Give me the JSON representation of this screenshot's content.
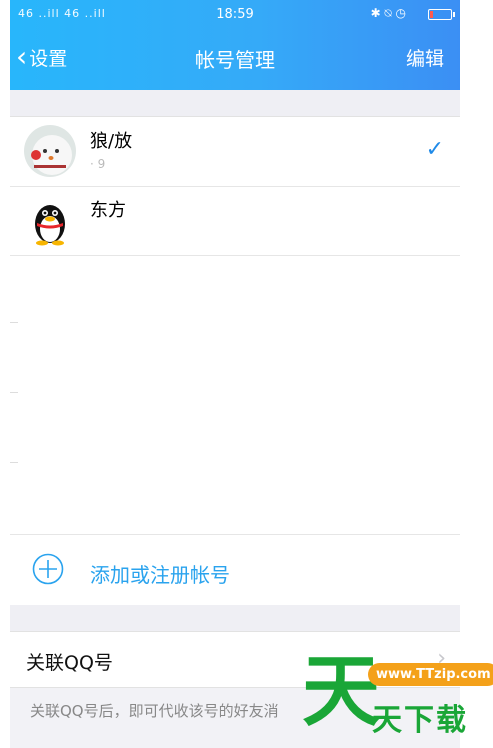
{
  "status_bar": {
    "signal": "46 ..ill 46 ..ill",
    "time": "18:59",
    "icons": "✱ ⍉ ◷"
  },
  "nav": {
    "back_label": "设置",
    "title": "帐号管理",
    "edit_label": "编辑"
  },
  "accounts": [
    {
      "name": "狼/放",
      "number": "·              9",
      "checked": true,
      "check_symbol": "✓",
      "avatar_icon": "snowman-photo-avatar"
    },
    {
      "name": "东方",
      "number": "",
      "checked": false,
      "avatar_icon": "qq-penguin-avatar"
    }
  ],
  "add_account": {
    "label": "添加或注册帐号",
    "icon": "plus-circle-icon"
  },
  "linked_qq": {
    "label": "关联QQ号",
    "arrow": "›",
    "description": "关联QQ号后，即可代收该号的好友消"
  },
  "watermark": {
    "url": "www.TTzip.com",
    "big_char": "天",
    "text": "天下载"
  },
  "colors": {
    "header_start": "#28b6fb",
    "header_end": "#3b8ff4",
    "accent": "#2aa3ee",
    "check": "#1f8ae8",
    "watermark_green": "#1aa637",
    "watermark_orange": "#f4a11a"
  }
}
